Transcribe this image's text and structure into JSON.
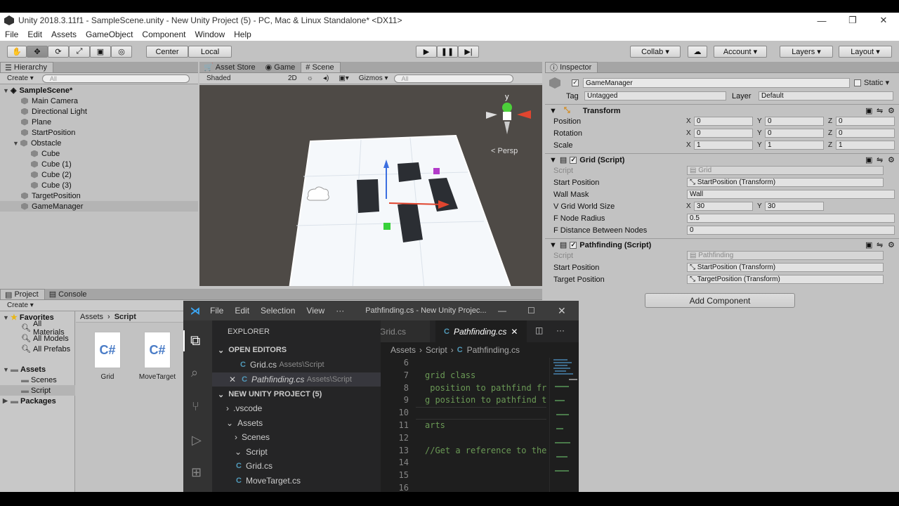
{
  "window": {
    "title": "Unity 2018.3.11f1 - SampleScene.unity - New Unity Project (5) - PC, Mac & Linux Standalone* <DX11>",
    "minimize": "—",
    "restore": "❐",
    "close": "✕"
  },
  "menu": [
    "File",
    "Edit",
    "Assets",
    "GameObject",
    "Component",
    "Window",
    "Help"
  ],
  "toolbar": {
    "center": "Center",
    "local": "Local",
    "collab": "Collab ▾",
    "account": "Account",
    "layers": "Layers",
    "layout": "Layout"
  },
  "hierarchy": {
    "tab": "Hierarchy",
    "create": "Create ▾",
    "search": "All",
    "scene": "SampleScene*",
    "items": [
      "Main Camera",
      "Directional Light",
      "Plane",
      "StartPosition",
      "Obstacle",
      "Cube",
      "Cube (1)",
      "Cube (2)",
      "Cube (3)",
      "TargetPosition",
      "GameManager"
    ]
  },
  "scene": {
    "tabs": [
      "Asset Store",
      "Game",
      "Scene"
    ],
    "shading": "Shaded",
    "mode2d": "2D",
    "gizmos": "Gizmos ▾",
    "search": "All",
    "persp": "< Persp",
    "axis_y": "y"
  },
  "inspector": {
    "tab": "Inspector",
    "object_name": "GameManager",
    "static": "Static",
    "tag_label": "Tag",
    "tag": "Untagged",
    "layer_label": "Layer",
    "layer": "Default",
    "transform": {
      "title": "Transform",
      "position": "Position",
      "rotation": "Rotation",
      "scale": "Scale",
      "pos": [
        "0",
        "0",
        "0"
      ],
      "rot": [
        "0",
        "0",
        "0"
      ],
      "scl": [
        "1",
        "1",
        "1"
      ]
    },
    "grid": {
      "title": "Grid (Script)",
      "script_label": "Script",
      "script": "Grid",
      "start_label": "Start Position",
      "start": "StartPosition (Transform)",
      "wall_label": "Wall Mask",
      "wall": "Wall",
      "size_label": "V Grid World Size",
      "size_x": "30",
      "size_y": "30",
      "radius_label": "F Node Radius",
      "radius": "0.5",
      "dist_label": "F Distance Between Nodes",
      "dist": "0"
    },
    "pathfinding": {
      "title": "Pathfinding (Script)",
      "script_label": "Script",
      "script": "Pathfinding",
      "start_label": "Start Position",
      "start": "StartPosition (Transform)",
      "target_label": "Target Position",
      "target": "TargetPosition (Transform)"
    },
    "add_component": "Add Component"
  },
  "project": {
    "tabs": [
      "Project",
      "Console"
    ],
    "create": "Create ▾",
    "favorites": "Favorites",
    "fav_items": [
      "All Materials",
      "All Models",
      "All Prefabs"
    ],
    "assets": "Assets",
    "asset_items": [
      "Scenes",
      "Script"
    ],
    "packages": "Packages",
    "breadcrumb": [
      "Assets",
      "Script"
    ],
    "files": [
      {
        "name": "Grid",
        "icon": "C#"
      },
      {
        "name": "MoveTarget",
        "icon": "C#"
      }
    ]
  },
  "vscode": {
    "menu": [
      "File",
      "Edit",
      "Selection",
      "View",
      "···"
    ],
    "title": "Pathfinding.cs - New Unity Projec...",
    "explorer_title": "EXPLORER",
    "open_editors": "OPEN EDITORS",
    "open_files": [
      {
        "name": "Grid.cs",
        "path": "Assets\\Script"
      },
      {
        "name": "Pathfinding.cs",
        "path": "Assets\\Script"
      }
    ],
    "project": "NEW UNITY PROJECT (5)",
    "tree": [
      ".vscode",
      "Assets",
      "Scenes",
      "Script",
      "Grid.cs",
      "MoveTarget.cs"
    ],
    "tabs": [
      "Grid.cs",
      "Pathfinding.cs"
    ],
    "breadcrumb": [
      "Assets",
      "Script",
      "Pathfinding.cs"
    ],
    "lines": [
      {
        "n": "6",
        "t": ""
      },
      {
        "n": "7",
        "t": "grid class"
      },
      {
        "n": "8",
        "t": " position to pathfind fro"
      },
      {
        "n": "9",
        "t": "g position to pathfind to"
      },
      {
        "n": "10",
        "t": ""
      },
      {
        "n": "11",
        "t": "arts"
      },
      {
        "n": "12",
        "t": ""
      },
      {
        "n": "13",
        "t": "//Get a reference to the"
      },
      {
        "n": "14",
        "t": ""
      },
      {
        "n": "15",
        "t": ""
      },
      {
        "n": "16",
        "t": ""
      }
    ]
  }
}
